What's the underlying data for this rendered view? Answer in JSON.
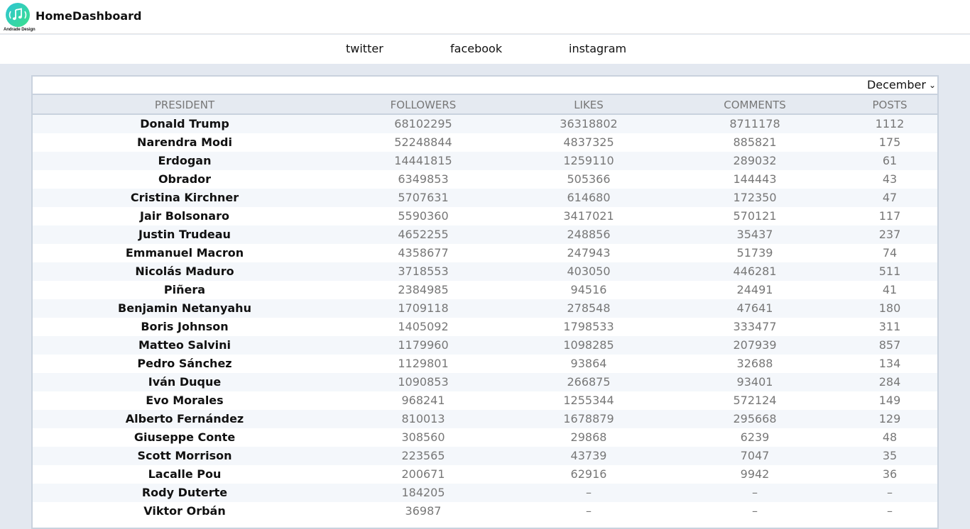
{
  "header": {
    "logo_caption": "Andrade Design",
    "brand": "HomeDashboard",
    "colors": {
      "logo_gradient_start": "#2ec4d6",
      "logo_gradient_end": "#3be08a"
    }
  },
  "nav": {
    "items": [
      {
        "label": "twitter"
      },
      {
        "label": "facebook"
      },
      {
        "label": "instagram"
      }
    ]
  },
  "filter": {
    "month_selected": "December",
    "chevron": "chevron-down-icon"
  },
  "table": {
    "columns": [
      "PRESIDENT",
      "FOLLOWERS",
      "LIKES",
      "COMMENTS",
      "POSTS"
    ],
    "rows": [
      {
        "president": "Donald Trump",
        "followers": "68102295",
        "likes": "36318802",
        "comments": "8711178",
        "posts": "1112"
      },
      {
        "president": "Narendra Modi",
        "followers": "52248844",
        "likes": "4837325",
        "comments": "885821",
        "posts": "175"
      },
      {
        "president": "Erdogan",
        "followers": "14441815",
        "likes": "1259110",
        "comments": "289032",
        "posts": "61"
      },
      {
        "president": "Obrador",
        "followers": "6349853",
        "likes": "505366",
        "comments": "144443",
        "posts": "43"
      },
      {
        "president": "Cristina Kirchner",
        "followers": "5707631",
        "likes": "614680",
        "comments": "172350",
        "posts": "47"
      },
      {
        "president": "Jair Bolsonaro",
        "followers": "5590360",
        "likes": "3417021",
        "comments": "570121",
        "posts": "117"
      },
      {
        "president": "Justin Trudeau",
        "followers": "4652255",
        "likes": "248856",
        "comments": "35437",
        "posts": "237"
      },
      {
        "president": "Emmanuel Macron",
        "followers": "4358677",
        "likes": "247943",
        "comments": "51739",
        "posts": "74"
      },
      {
        "president": "Nicolás Maduro",
        "followers": "3718553",
        "likes": "403050",
        "comments": "446281",
        "posts": "511"
      },
      {
        "president": "Piñera",
        "followers": "2384985",
        "likes": "94516",
        "comments": "24491",
        "posts": "41"
      },
      {
        "president": "Benjamin Netanyahu",
        "followers": "1709118",
        "likes": "278548",
        "comments": "47641",
        "posts": "180"
      },
      {
        "president": "Boris Johnson",
        "followers": "1405092",
        "likes": "1798533",
        "comments": "333477",
        "posts": "311"
      },
      {
        "president": "Matteo Salvini",
        "followers": "1179960",
        "likes": "1098285",
        "comments": "207939",
        "posts": "857"
      },
      {
        "president": "Pedro Sánchez",
        "followers": "1129801",
        "likes": "93864",
        "comments": "32688",
        "posts": "134"
      },
      {
        "president": "Iván Duque",
        "followers": "1090853",
        "likes": "266875",
        "comments": "93401",
        "posts": "284"
      },
      {
        "president": "Evo Morales",
        "followers": "968241",
        "likes": "1255344",
        "comments": "572124",
        "posts": "149"
      },
      {
        "president": "Alberto Fernández",
        "followers": "810013",
        "likes": "1678879",
        "comments": "295668",
        "posts": "129"
      },
      {
        "president": "Giuseppe Conte",
        "followers": "308560",
        "likes": "29868",
        "comments": "6239",
        "posts": "48"
      },
      {
        "president": "Scott Morrison",
        "followers": "223565",
        "likes": "43739",
        "comments": "7047",
        "posts": "35"
      },
      {
        "president": "Lacalle Pou",
        "followers": "200671",
        "likes": "62916",
        "comments": "9942",
        "posts": "36"
      },
      {
        "president": "Rody Duterte",
        "followers": "184205",
        "likes": "–",
        "comments": "–",
        "posts": "–"
      },
      {
        "president": "Viktor Orbán",
        "followers": "36987",
        "likes": "–",
        "comments": "–",
        "posts": "–"
      }
    ]
  }
}
